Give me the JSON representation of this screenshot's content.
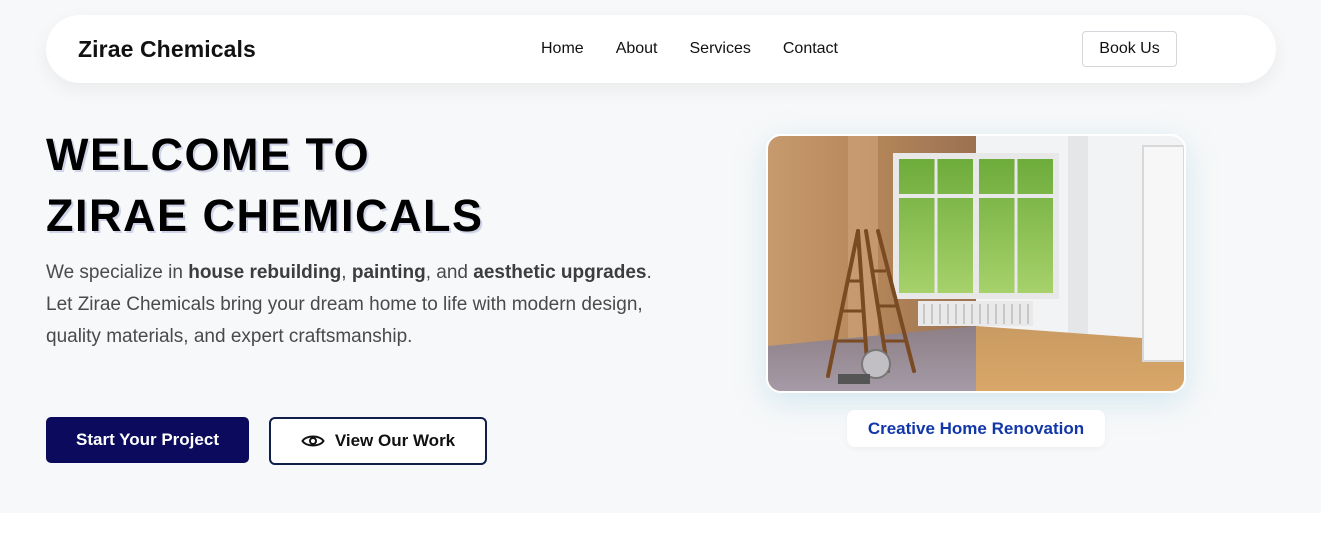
{
  "nav": {
    "brand": "Zirae Chemicals",
    "links": [
      "Home",
      "About",
      "Services",
      "Contact"
    ],
    "book_label": "Book Us"
  },
  "hero": {
    "title_line1": "WELCOME TO",
    "title_line2": "ZIRAE CHEMICALS",
    "desc": {
      "p1_a": "We specialize in ",
      "p1_b": "house rebuilding",
      "p1_c": ", ",
      "p1_d": "painting",
      "p1_e": ", and ",
      "p1_f": "aesthetic upgrades",
      "p1_g": ".",
      "p2": "Let Zirae Chemicals bring your dream home to life with modern design, quality materials, and expert craftsmanship."
    },
    "primary_cta": "Start Your Project",
    "secondary_cta": "View Our Work",
    "secondary_icon": "eye-icon",
    "image_caption": "Creative Home Renovation"
  },
  "colors": {
    "primary": "#0b0a5c",
    "caption_text": "#1237a8",
    "hero_bg": "#f7f8f9"
  }
}
